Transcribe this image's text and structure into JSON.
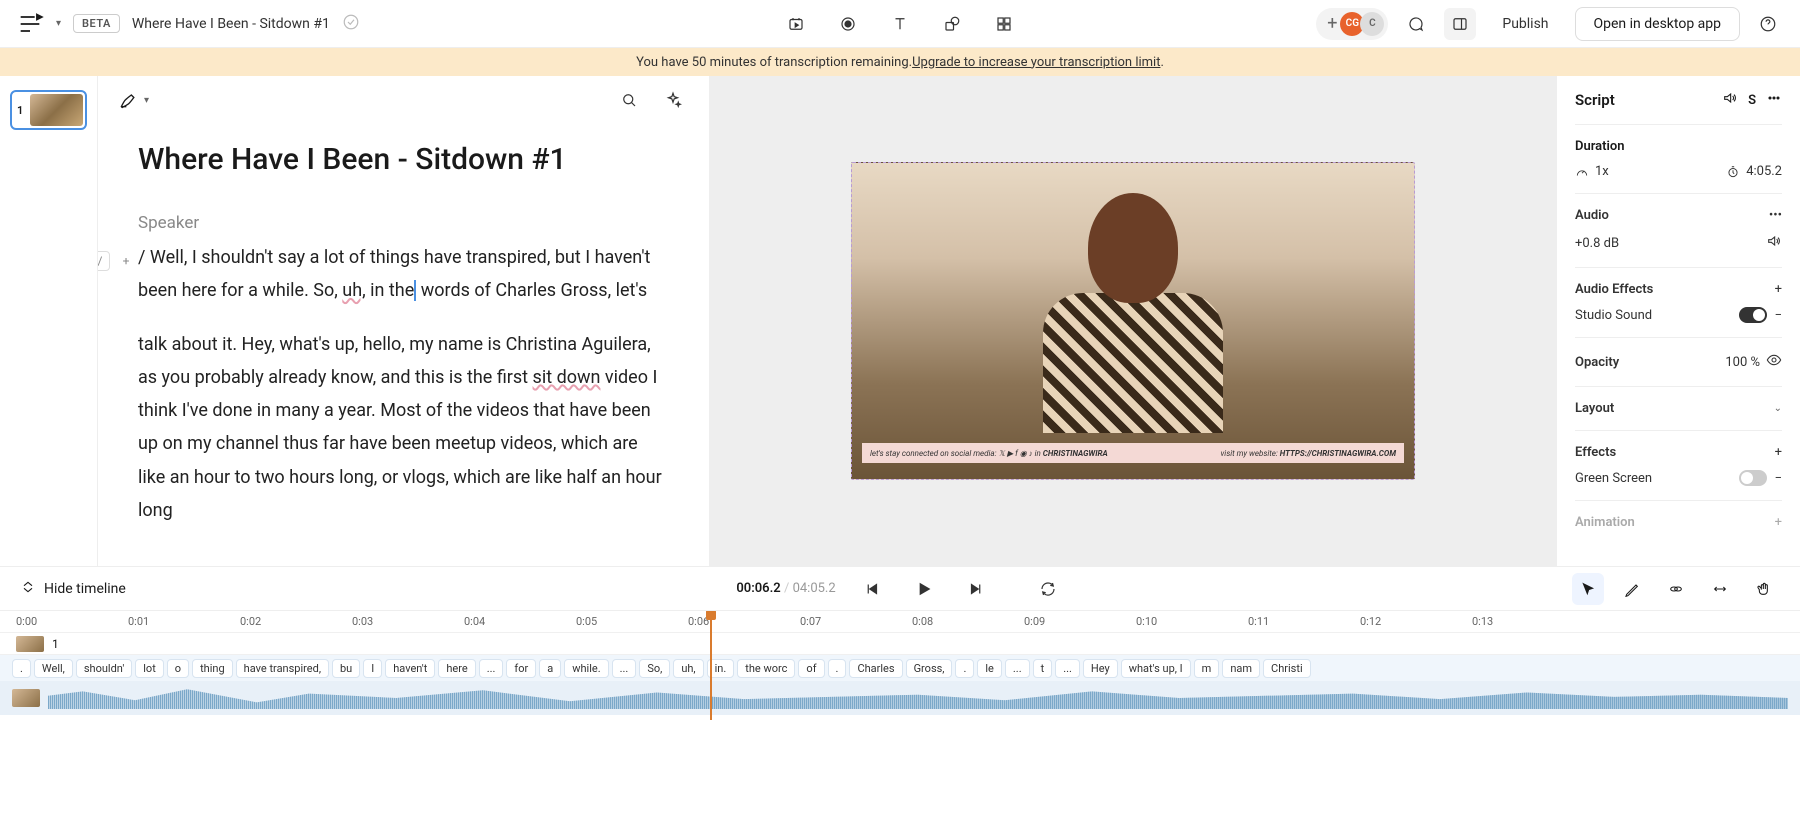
{
  "header": {
    "beta": "BETA",
    "title": "Where Have I Been - Sitdown #1",
    "publish": "Publish",
    "desktop": "Open in desktop app",
    "avatar1": "CG",
    "avatar2": "C"
  },
  "banner": {
    "text_before": "You have 50 minutes of transcription remaining. ",
    "link": "Upgrade to increase your transcription limit",
    "text_after": "."
  },
  "scene": {
    "number": "1"
  },
  "doc": {
    "heading": "Where Have I Been - Sitdown #1",
    "speaker": "Speaker",
    "p1a": "/ Well, I shouldn't say a lot of things have transpired, but I haven't been here for a while. So, ",
    "p1_wavy": "uh,",
    "p1b": " in the",
    "p1c": " words of Charles Gross, let's",
    "p2a": "talk about it. Hey, what's up, hello, my name is Christina Aguilera, as you probably already know, and this is the first ",
    "p2_wavy1": "sit down",
    "p2b": " video I think I've done in many a year. Most of the videos that have been up on my channel thus far have been meetup videos, which are like an hour to two hours long, or vlogs, which are like half an hour long"
  },
  "video": {
    "overlay_left": "let's stay connected on social media:",
    "overlay_handle": "CHRISTINAGWIRA",
    "overlay_right_label": "visit my website:",
    "overlay_url": "HTTPS://CHRISTINAGWIRA.COM"
  },
  "props": {
    "title": "Script",
    "speaker_btn": "S",
    "duration_label": "Duration",
    "speed": "1x",
    "total_time": "4:05.2",
    "audio_label": "Audio",
    "gain": "+0.8 dB",
    "effects_label": "Audio Effects",
    "studio": "Studio Sound",
    "opacity_label": "Opacity",
    "opacity_value": "100 %",
    "layout_label": "Layout",
    "fx_label": "Effects",
    "green": "Green Screen",
    "anim": "Animation"
  },
  "timeline": {
    "hide": "Hide timeline",
    "current": "00:06.2",
    "total": "04:05.2",
    "ticks": [
      "0:00",
      "0:01",
      "0:02",
      "0:03",
      "0:04",
      "0:05",
      "0:06",
      "0:07",
      "0:08",
      "0:09",
      "0:10",
      "0:11",
      "0:12",
      "0:13"
    ],
    "track_label": "1",
    "words": [
      ".",
      "Well,",
      "shouldn'",
      "lot",
      "o",
      "thing",
      "have transpired,",
      "bu",
      "I",
      "haven't",
      "here",
      "...",
      "for",
      "a",
      "while.",
      "...",
      "So,",
      "uh,",
      "in.",
      "the worc",
      "of",
      ".",
      "Charles",
      "Gross,",
      ".",
      "le",
      "...",
      "t",
      "...",
      "Hey",
      "what's up, I",
      "m",
      "nam",
      "Christi"
    ]
  }
}
